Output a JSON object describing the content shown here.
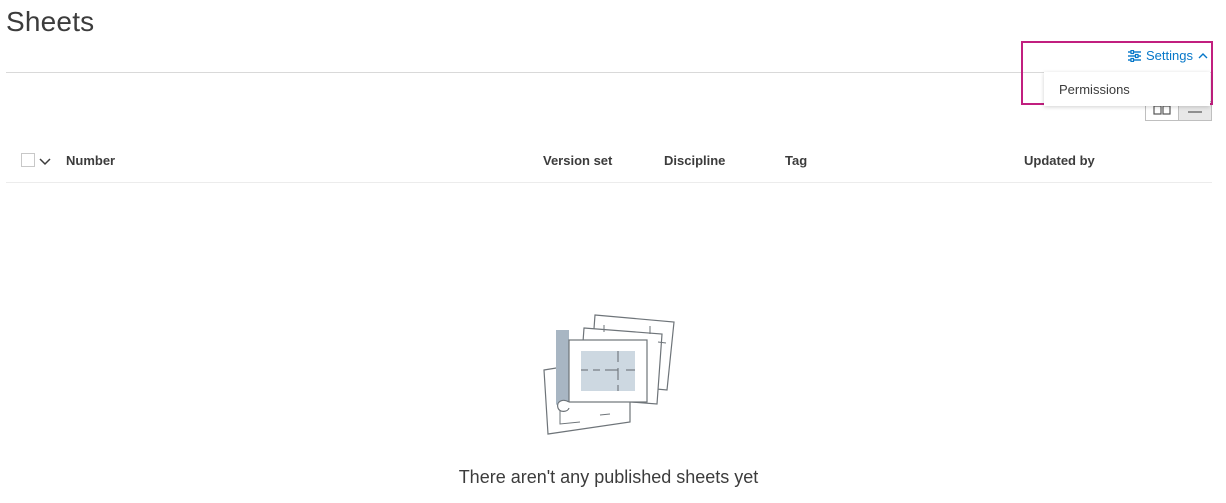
{
  "page": {
    "title": "Sheets"
  },
  "toolbar": {
    "settings_label": "Settings"
  },
  "settings_menu": {
    "items": [
      {
        "label": "Permissions"
      }
    ]
  },
  "table": {
    "columns": [
      "Number",
      "Version set",
      "Discipline",
      "Tag",
      "Updated by"
    ]
  },
  "empty_state": {
    "message": "There aren't any published sheets yet"
  },
  "colors": {
    "accent": "#0677c9",
    "highlight": "#c11f7f",
    "text": "#3c3c3c"
  }
}
